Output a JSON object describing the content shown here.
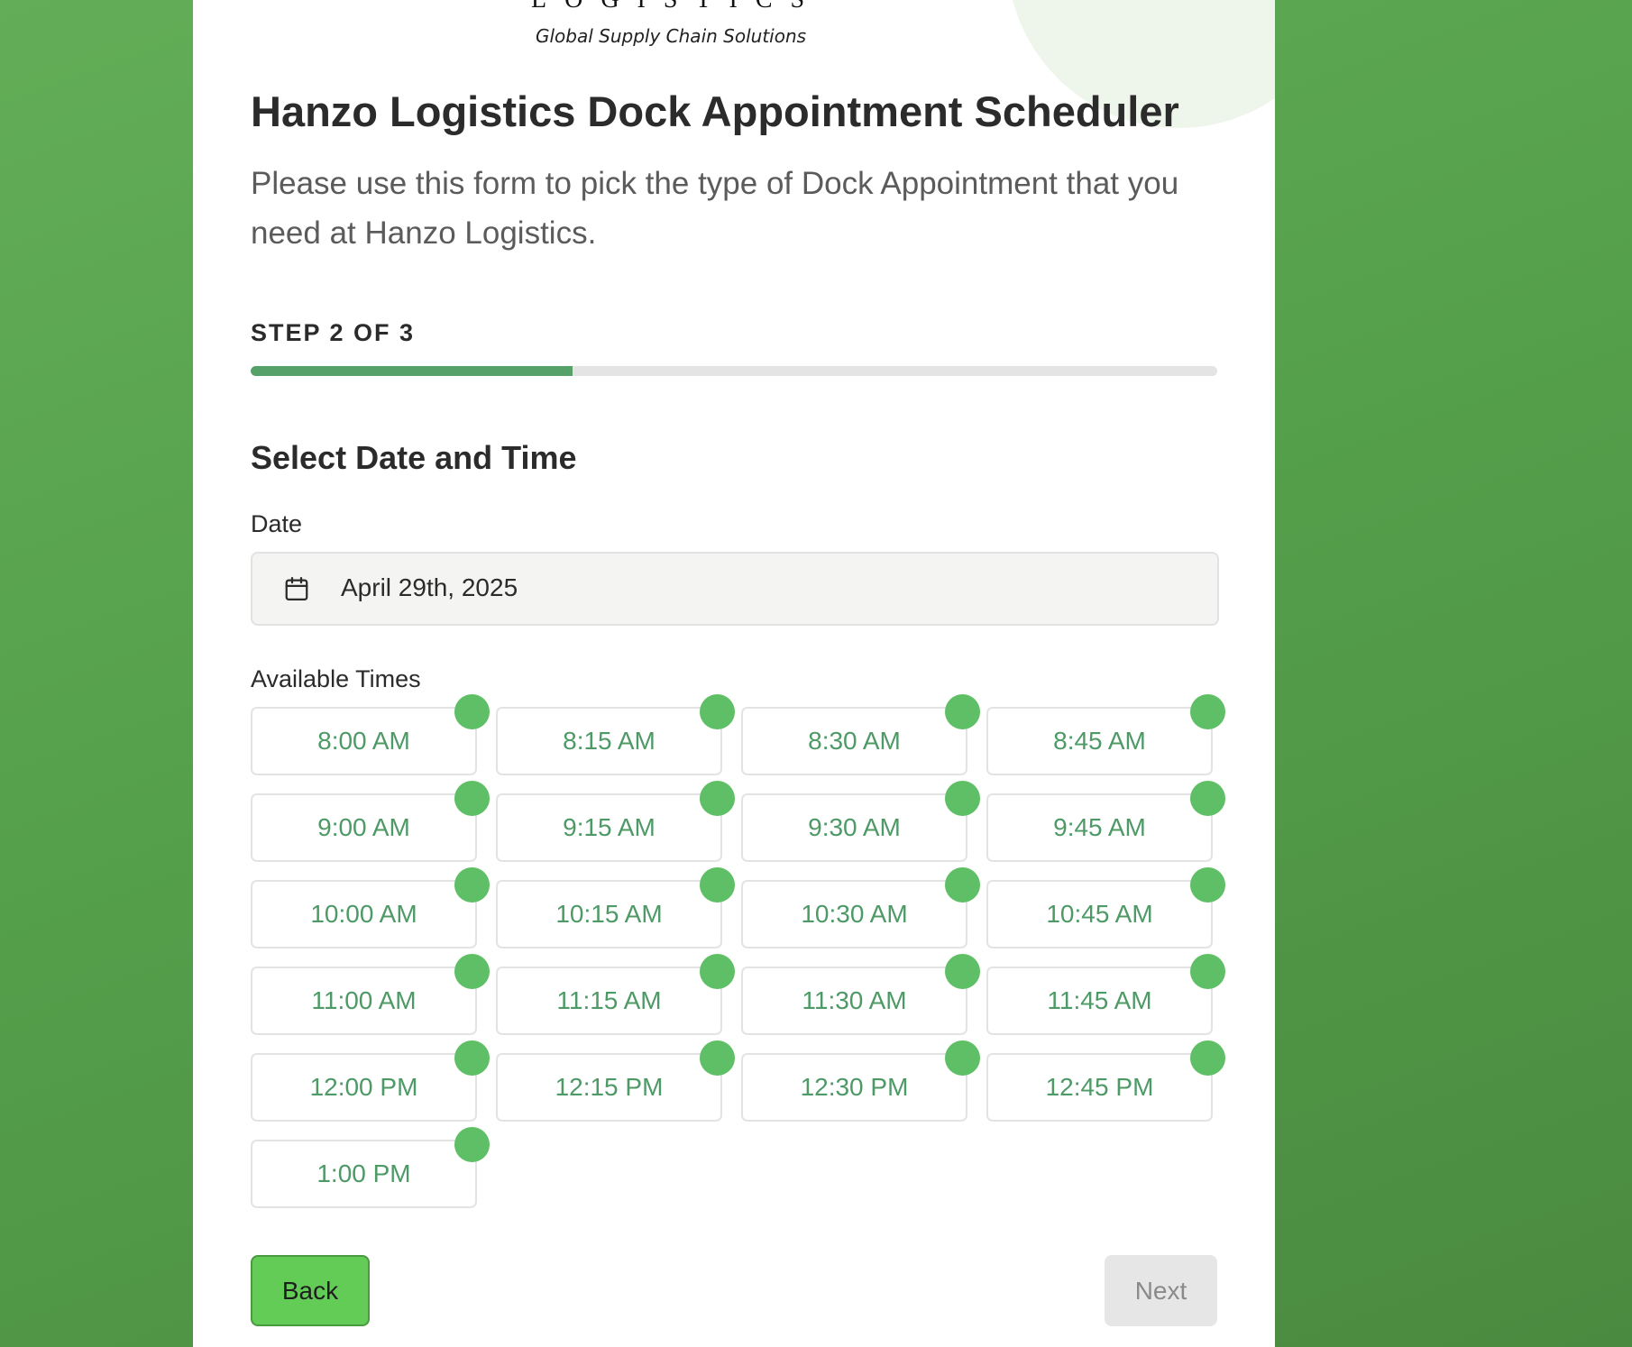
{
  "brand": {
    "logo_word": "LOGISTICS",
    "tagline": "Global Supply Chain Solutions"
  },
  "header": {
    "title": "Hanzo Logistics Dock Appointment Scheduler",
    "description": "Please use this form to pick the type of Dock Appointment that you need at Hanzo Logistics."
  },
  "progress": {
    "step_label": "STEP 2 OF 3",
    "current_step": 2,
    "total_steps": 3,
    "fraction": 0.333
  },
  "section": {
    "title": "Select Date and Time"
  },
  "date": {
    "label": "Date",
    "icon": "calendar-icon",
    "value": "April 29th, 2025"
  },
  "times": {
    "label": "Available Times",
    "slots": [
      "8:00 AM",
      "8:15 AM",
      "8:30 AM",
      "8:45 AM",
      "9:00 AM",
      "9:15 AM",
      "9:30 AM",
      "9:45 AM",
      "10:00 AM",
      "10:15 AM",
      "10:30 AM",
      "10:45 AM",
      "11:00 AM",
      "11:15 AM",
      "11:30 AM",
      "11:45 AM",
      "12:00 PM",
      "12:15 PM",
      "12:30 PM",
      "12:45 PM",
      "1:00 PM"
    ]
  },
  "buttons": {
    "back": "Back",
    "next": "Next"
  },
  "colors": {
    "background": "#5aa550",
    "accent": "#56a06a",
    "slot_text": "#4d9a66",
    "availability_dot": "#5ebf66",
    "back_button": "#63cc57",
    "next_disabled": "#e6e6e6"
  }
}
